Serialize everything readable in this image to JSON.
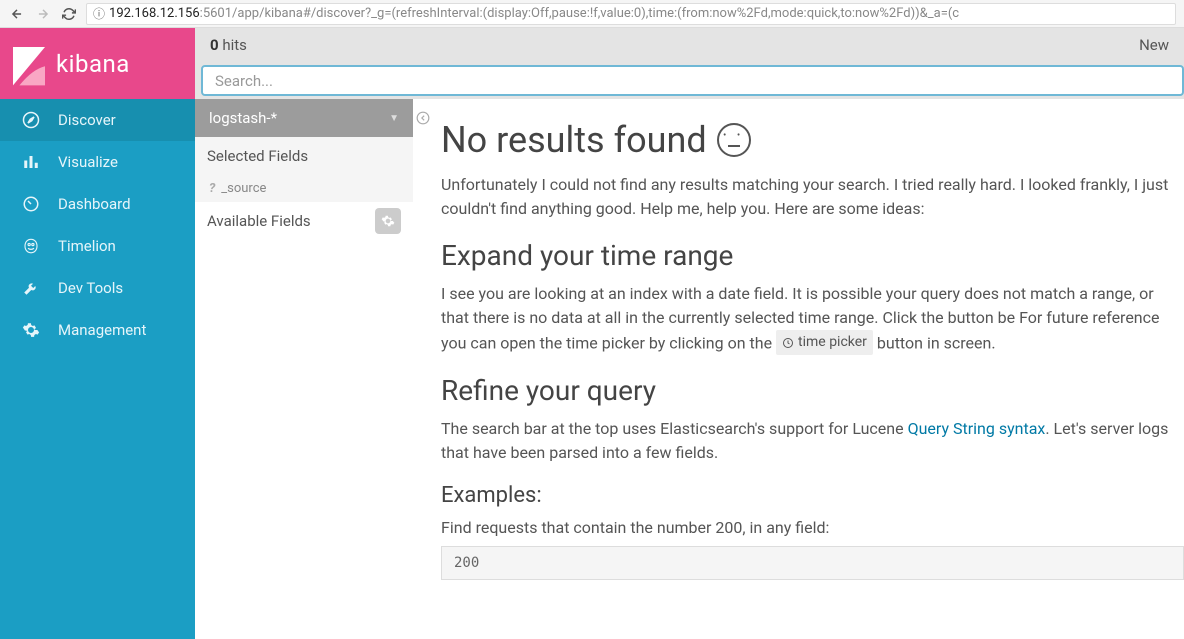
{
  "browser": {
    "url_host": "192.168.12.156",
    "url_path": ":5601/app/kibana#/discover?_g=(refreshInterval:(display:Off,pause:!f,value:0),time:(from:now%2Fd,mode:quick,to:now%2Fd))&_a=(c"
  },
  "brand": "kibana",
  "nav": {
    "discover": "Discover",
    "visualize": "Visualize",
    "dashboard": "Dashboard",
    "timelion": "Timelion",
    "devtools": "Dev Tools",
    "management": "Management"
  },
  "topbar": {
    "hits_count": "0",
    "hits_label": " hits",
    "new": "New"
  },
  "search": {
    "placeholder": "Search..."
  },
  "fields": {
    "index_pattern": "logstash-*",
    "selected_header": "Selected Fields",
    "source_field": "_source",
    "source_type": "?",
    "available_header": "Available Fields"
  },
  "results": {
    "heading": "No results found",
    "intro": "Unfortunately I could not find any results matching your search. I tried really hard. I looked frankly, I just couldn't find anything good. Help me, help you. Here are some ideas:",
    "expand_heading": "Expand your time range",
    "expand_text_1": "I see you are looking at an index with a date field. It is possible your query does not match a range, or that there is no data at all in the currently selected time range. Click the button be For future reference you can open the time picker by clicking on the ",
    "time_picker_chip": "time picker",
    "expand_text_2": " button in screen.",
    "refine_heading": "Refine your query",
    "refine_text_1": "The search bar at the top uses Elasticsearch's support for Lucene ",
    "query_syntax_link": "Query String syntax",
    "refine_text_2": ". Let's server logs that have been parsed into a few fields.",
    "examples_heading": "Examples:",
    "example_label": "Find requests that contain the number 200, in any field:",
    "example_code": "200"
  }
}
